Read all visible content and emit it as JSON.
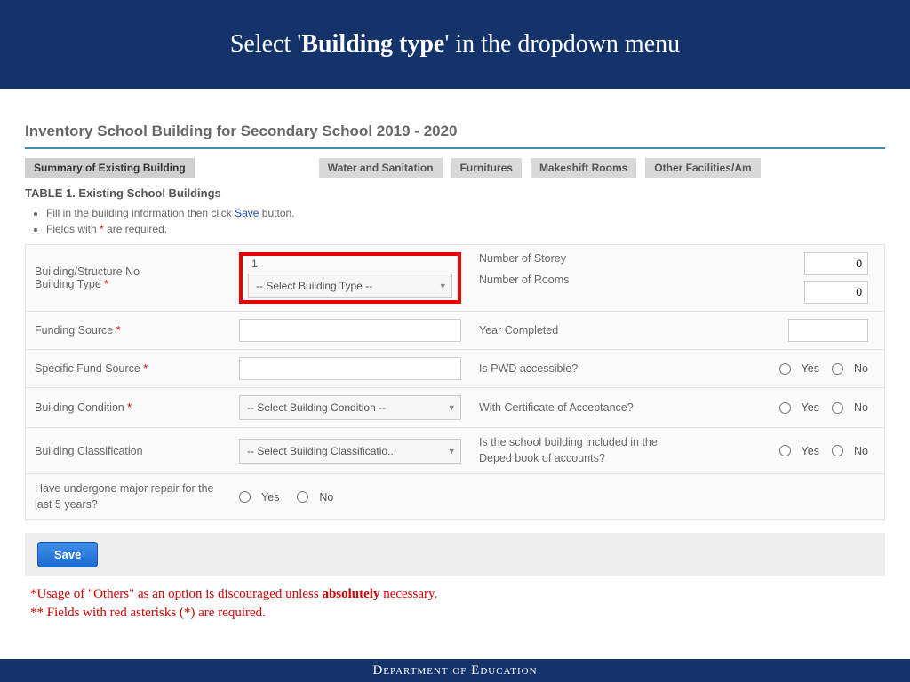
{
  "banner": {
    "pre": "Select '",
    "emph": "Building type",
    "post": "' in the dropdown menu"
  },
  "page_title": "Inventory School Building for Secondary School 2019 - 2020",
  "tabs": [
    "Summary of Existing Building",
    "Water and Sanitation",
    "Furnitures",
    "Makeshift Rooms",
    "Other Facilities/Am"
  ],
  "table_title": "TABLE 1. Existing School Buildings",
  "notes": {
    "line1_pre": "Fill in the building information then click ",
    "line1_link": "Save",
    "line1_post": " button.",
    "line2_pre": "Fields with ",
    "line2_mark": "*",
    "line2_post": " are required."
  },
  "labels": {
    "building_no": "Building/Structure No",
    "building_type": "Building Type ",
    "funding_source": "Funding Source ",
    "specific_fund": "Specific Fund Source ",
    "building_condition": "Building Condition ",
    "building_classification": "Building Classification",
    "major_repair": "Have undergone major repair for the last 5 years?",
    "num_storey": "Number of Storey",
    "num_rooms": "Number of Rooms",
    "year_completed": "Year Completed",
    "pwd": "Is PWD accessible?",
    "coa": "With Certificate of Acceptance?",
    "book": "Is the school building included in the Deped book of accounts?"
  },
  "values": {
    "building_no": "1",
    "storey": "0",
    "rooms": "0",
    "year": "",
    "funding": "",
    "specific": ""
  },
  "selects": {
    "building_type": "-- Select Building Type --",
    "condition": "-- Select Building Condition --",
    "classification": "-- Select Building Classificatio..."
  },
  "radio": {
    "yes": "Yes",
    "no": "No"
  },
  "save_label": "Save",
  "footnotes": {
    "l1_pre": "*Usage of \"Others\" as an option is discouraged unless ",
    "l1_bold": "absolutely",
    "l1_post": " necessary.",
    "l2": "** Fields with red asterisks (*) are required."
  },
  "footer": "Department of Education"
}
